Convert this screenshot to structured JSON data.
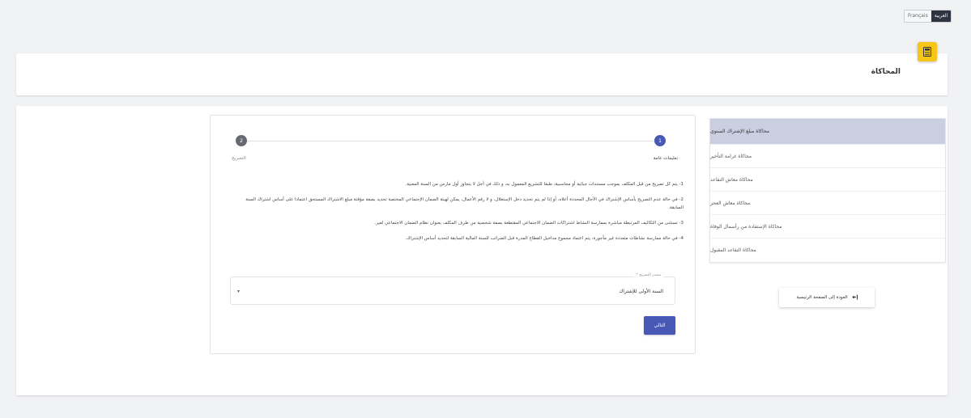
{
  "language": {
    "active": "العربية",
    "inactive": "Français"
  },
  "header": {
    "title": "المحاكاة",
    "icon": "calculator-icon",
    "accent": "#f5c518"
  },
  "sidebar": {
    "items": [
      {
        "label": "محاكاة مبلغ الإشتراك السنوي"
      },
      {
        "label": "محاكاة غرامة التأخير"
      },
      {
        "label": "محاكاة معاش التقاعد"
      },
      {
        "label": "محاكاة معاش العجز"
      },
      {
        "label": "محاكاة الإستفادة من رأسمال الوفاة"
      },
      {
        "label": "محاكاة التقاعد المقبول"
      }
    ],
    "selected_color": "#c9cee0",
    "home_button": "العودة إلى الصفحة الرئيسية"
  },
  "stepper": {
    "steps": [
      {
        "number": "1",
        "label": "تعليمات عامة"
      },
      {
        "number": "2",
        "label": "التصريح"
      }
    ],
    "active_color": "#4759b4"
  },
  "instructions": [
    "1- يتم كل تصريح من قبل المكلف بموجب مستندات جبائية أو محاسبية، طبقا للتشريع المعمول به، و ذلك في أجل لا يتجاوز أول مارس من السنة المعنية.",
    "2- في حالة عدم التصريح بأساس الإشتراك في الآجال المحددة أعلاه، أو إذا لم يتم تحديد دخل الإستغلال، و لا رقم الأعمال، يمكن لهيئة الضمان الإجتماعي المختصة تحديد بصفة مؤقتة مبلغ الاشتراك المستحق اعتمادا على أساس اشتراك السنة السابقة.",
    "3- تستثنى من التكاليف المرتبطة مباشرة بممارسة النشاط اشتراكات الضمان الاجتماعي المقتطعة بصفة شخصية من طرف المكلف بعنوان نظام الضمان الاجتماعي لغير.",
    "4- في حالة ممارسة نشاطات متعددة غير مأجورة، يتم اعتماد مجموع مداخيل القطاع المدرة قبل الضرائب للسنة المالية السابقة لتحديد أساس الإشتراك."
  ],
  "form": {
    "select_label": "مصدر التصريح *",
    "select_value": "السنة الأولى للإشتراك",
    "next_button": "التالي"
  }
}
